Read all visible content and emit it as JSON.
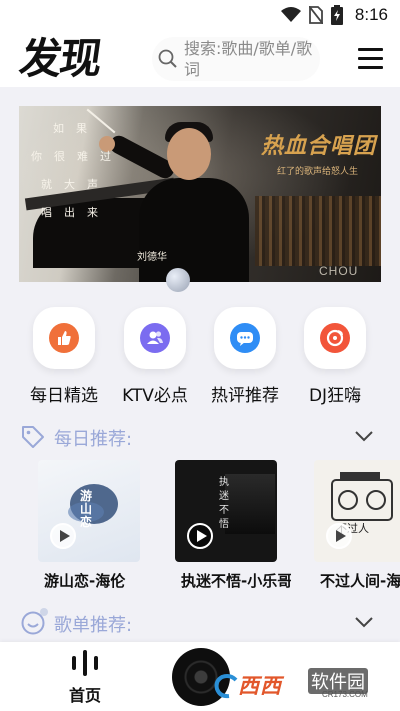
{
  "status_bar": {
    "time": "8:16",
    "icons": [
      "wifi-icon",
      "no-sim-icon",
      "battery-charging-icon"
    ]
  },
  "header": {
    "title": "发现",
    "search_placeholder": "搜索:歌曲/歌单/歌词",
    "menu_icon": "hamburger-menu-icon"
  },
  "banner": {
    "poem_lines": [
      "如果",
      "你很难过",
      "就大声",
      "唱出来"
    ],
    "title": "热血合唱团",
    "subtitle": "红了的歌声给怒人生",
    "caption": "刘德华",
    "corner_text": "CHOU"
  },
  "categories": [
    {
      "label": "每日精选",
      "icon": "thumbs-up-icon",
      "color": "#f0703a"
    },
    {
      "label": "KTV必点",
      "icon": "users-icon",
      "color": "#7b6cf0"
    },
    {
      "label": "热评推荐",
      "icon": "chat-bubble-icon",
      "color": "#2f8df5"
    },
    {
      "label": "DJ狂嗨",
      "icon": "disc-icon",
      "color": "#f2553a"
    }
  ],
  "daily": {
    "title": "每日推荐:",
    "icon": "tag-icon",
    "cards": [
      {
        "title": "游山恋-海伦",
        "cover_title": "游山恋",
        "cover_color": "#e9edf3"
      },
      {
        "title": "执迷不悟-小乐哥",
        "cover_title": "执迷不悟",
        "cover_color": "#141414"
      },
      {
        "title": "不过人间-海来阿木",
        "cover_title": "不过人",
        "cover_color": "#f3f1ec"
      }
    ]
  },
  "playlists": {
    "title": "歌单推荐:",
    "icon": "smiley-icon"
  },
  "bottom_nav": {
    "home_label": "首页",
    "home_icon": "sound-wave-icon",
    "player_icon": "vinyl-disc-icon"
  },
  "watermark": {
    "text": "西西",
    "brand": "软件园",
    "url": "CR173.COM"
  },
  "colors": {
    "accent_section": "#9aa8d8",
    "background": "#f1f1f6"
  }
}
